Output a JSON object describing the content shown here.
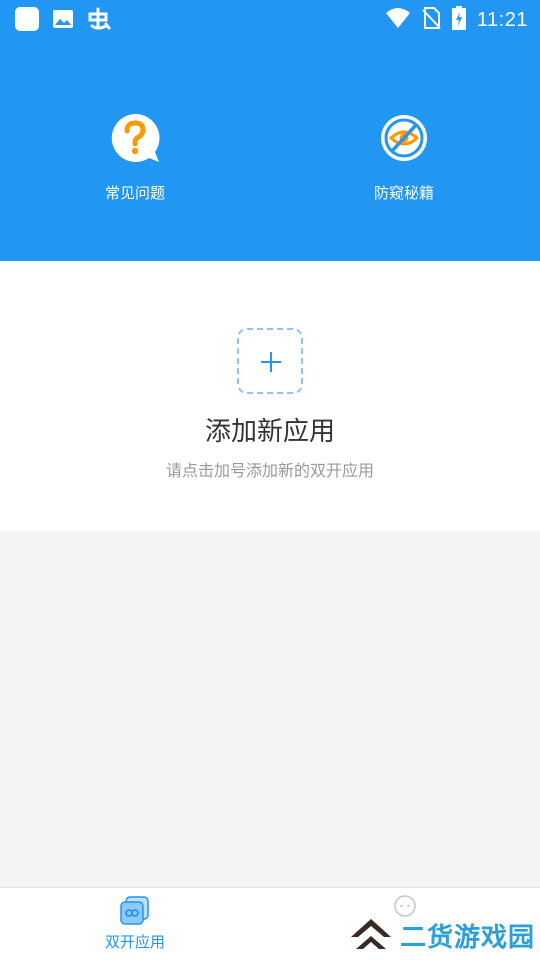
{
  "status_bar": {
    "time": "11:21",
    "left_icons": [
      "app-notification-icon",
      "image-icon",
      "bug-app-icon"
    ],
    "right_icons": [
      "wifi-icon",
      "no-sim-icon",
      "battery-charging-icon"
    ]
  },
  "header": {
    "color": "#2196f3",
    "quick_actions": [
      {
        "label": "常见问题",
        "icon": "question-bubble-icon",
        "icon_color": "#ff9800"
      },
      {
        "label": "防窥秘籍",
        "icon": "eye-slash-icon",
        "icon_color": "#ff9800"
      }
    ]
  },
  "add_panel": {
    "icon": "plus-icon",
    "title": "添加新应用",
    "subtitle": "请点击加号添加新的双开应用"
  },
  "bottom_nav": {
    "items": [
      {
        "label": "双开应用",
        "icon": "dual-app-icon",
        "active": true
      },
      {
        "label": "",
        "icon": "chat-bubble-icon",
        "active": false
      }
    ]
  },
  "watermark": {
    "text": "二货游戏园",
    "icon": "chevron-logo-icon"
  }
}
